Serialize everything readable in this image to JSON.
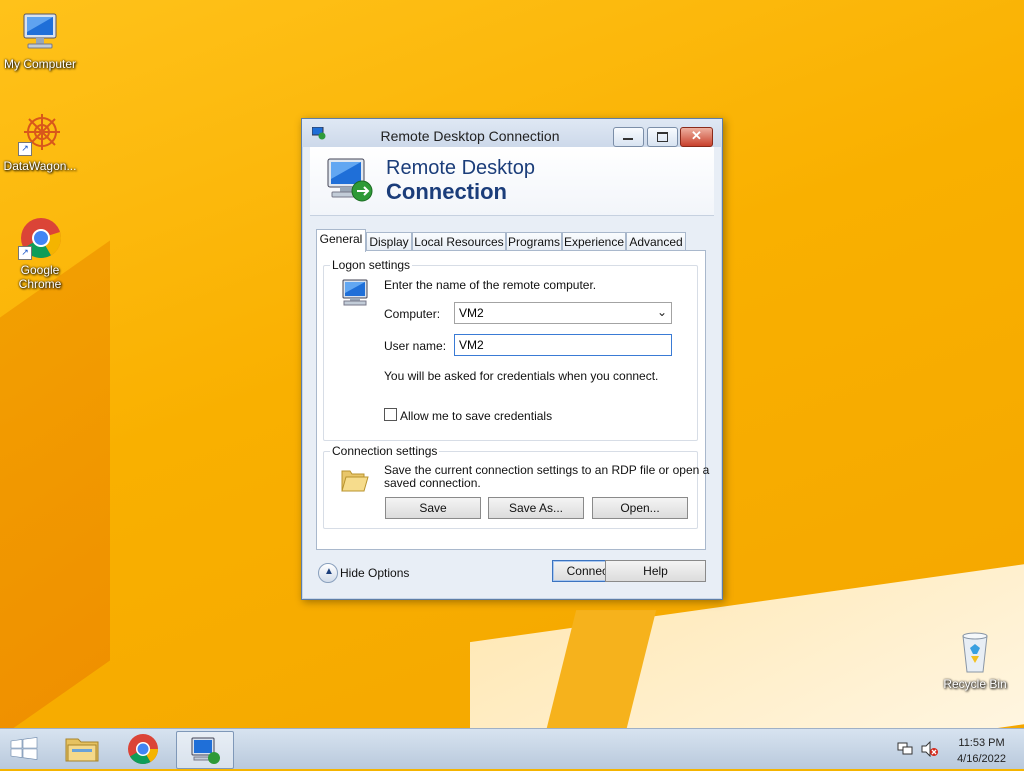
{
  "desktop": {
    "icons": [
      {
        "label": "My Computer"
      },
      {
        "label": "DataWagon..."
      },
      {
        "label": "Google Chrome"
      },
      {
        "label": "Recycle Bin"
      }
    ]
  },
  "window": {
    "title": "Remote Desktop Connection",
    "banner_line1": "Remote Desktop",
    "banner_line2": "Connection",
    "tabs": [
      {
        "label": "General"
      },
      {
        "label": "Display"
      },
      {
        "label": "Local Resources"
      },
      {
        "label": "Programs"
      },
      {
        "label": "Experience"
      },
      {
        "label": "Advanced"
      }
    ],
    "logon": {
      "group_label": "Logon settings",
      "instruction": "Enter the name of the remote computer.",
      "computer_label": "Computer:",
      "computer_value": "VM2",
      "username_label": "User name:",
      "username_value": "VM2",
      "credentials_note": "You will be asked for credentials when you connect.",
      "save_credentials_label": "Allow me to save credentials",
      "save_credentials_checked": false
    },
    "connection": {
      "group_label": "Connection settings",
      "description_line1": "Save the current connection settings to an RDP file or open a",
      "description_line2": "saved connection.",
      "save_label": "Save",
      "save_as_label": "Save As...",
      "open_label": "Open..."
    },
    "footer": {
      "hide_options_label": "Hide Options",
      "connect_label": "Connect",
      "help_label": "Help"
    }
  },
  "taskbar": {
    "time": "11:53 PM",
    "date": "4/16/2022"
  },
  "colors": {
    "desktop_bg": "#f9b000",
    "banner_text": "#1b3d7a",
    "close_button": "#c8412c"
  },
  "icons": [
    "computer-icon",
    "datawagon-icon",
    "chrome-icon",
    "recycle-bin-icon",
    "start-icon",
    "file-explorer-icon",
    "remote-desktop-icon",
    "network-icon",
    "speaker-muted-icon"
  ]
}
